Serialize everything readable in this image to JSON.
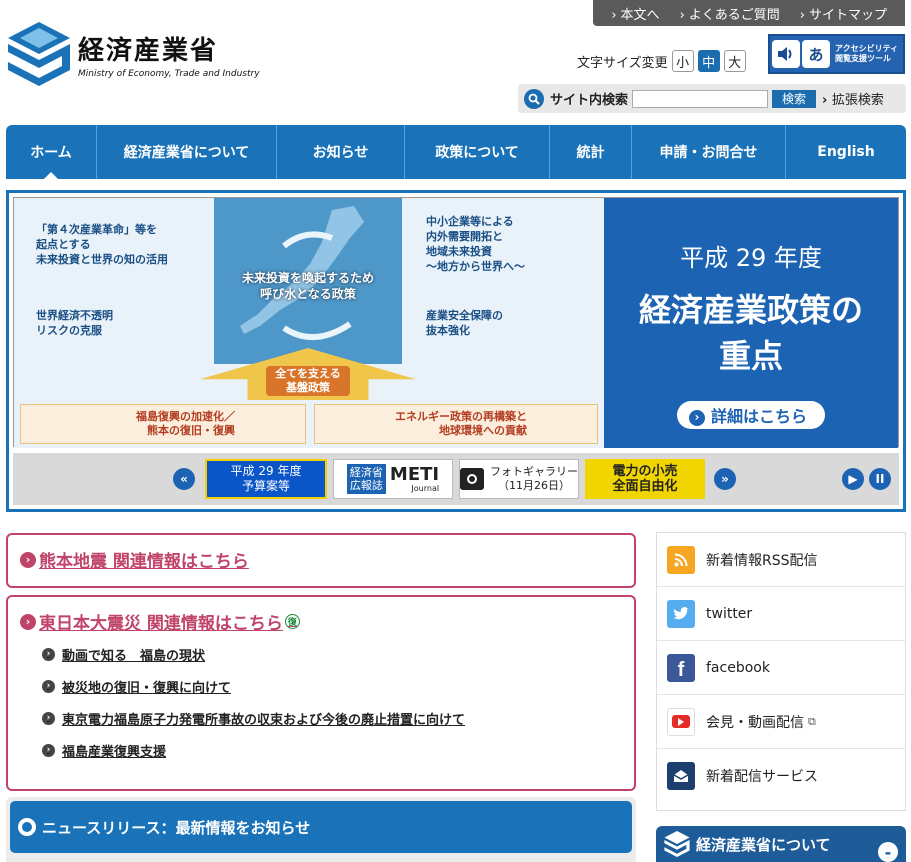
{
  "header": {
    "util_links": [
      "本文へ",
      "よくあるご質問",
      "サイトマップ"
    ],
    "logo_ja": "経済産業省",
    "logo_en": "Ministry of Economy, Trade and Industry",
    "font_size_label": "文字サイズ変更",
    "font_sizes": [
      "小",
      "中",
      "大"
    ],
    "a11y_icon_text": "あ",
    "a11y_line1": "アクセシビリティ",
    "a11y_line2": "閲覧支援ツール",
    "search_label": "サイト内検索",
    "search_button": "検索",
    "advanced_search": "拡張検索"
  },
  "nav": [
    "ホーム",
    "経済産業省について",
    "お知らせ",
    "政策について",
    "統計",
    "申請・お問合せ",
    "English"
  ],
  "banner": {
    "center_text_1": "未来投資を喚起するため",
    "center_text_2": "呼び水となる政策",
    "cell1_l1": "「第４次産業革命」等を",
    "cell1_l2": "起点とする",
    "cell1_l3": "未来投資と世界の知の活用",
    "cell2_l1": "中小企業等による",
    "cell2_l2": "内外需要開拓と",
    "cell2_l3": "地域未来投資",
    "cell2_l4": "〜地方から世界へ〜",
    "cell3_l1": "世界経済不透明",
    "cell3_l2": "リスクの克服",
    "cell4_l1": "産業安全保障の",
    "cell4_l2": "抜本強化",
    "arrow_l1": "全てを支える",
    "arrow_l2": "基盤政策",
    "box1_l1": "福島復興の加速化／",
    "box1_l2": "熊本の復旧・復興",
    "box2_l1": "エネルギー政策の再構築と",
    "box2_l2": "地球環境への貢献",
    "year": "平成 29 年度",
    "heading_l1": "経済産業政策の",
    "heading_l2": "重点",
    "detail": "詳細はこちら"
  },
  "carousel": {
    "prev": "«",
    "next": "»",
    "play": "▶",
    "pause": "II",
    "thumb1_l1": "平成 29 年度",
    "thumb1_l2": "予算案等",
    "thumb2_l1": "経済省",
    "thumb2_l2": "広報誌",
    "thumb2_logo": "METI",
    "thumb2_sub": "Journal",
    "thumb3_l1": "フォトギャラリー",
    "thumb3_l2": "（11月26日）",
    "thumb4_l1": "電力の小売",
    "thumb4_l2": "全面自由化"
  },
  "alerts": {
    "kumamoto": "熊本地震 関連情報はこちら",
    "tohoku": "東日本大震災 関連情報はこちら",
    "fukkou_badge": "復",
    "sublinks": [
      "動画で知る　福島の現状",
      "被災地の復旧・復興に向けて",
      "東京電力福島原子力発電所事故の収束および今後の廃止措置に向けて",
      "福島産業復興支援"
    ]
  },
  "news": {
    "title": "ニュースリリース：最新情報をお知らせ"
  },
  "sidebar": {
    "items": [
      "新着情報RSS配信",
      "twitter",
      "facebook",
      "会見・動画配信",
      "新着配信サービス"
    ],
    "about": "経済産業省について",
    "about_toggle": "-"
  },
  "colors": {
    "nav_blue": "#1a73b9",
    "alert_pink": "#c0446a",
    "banner_blue": "#1d63b3"
  }
}
